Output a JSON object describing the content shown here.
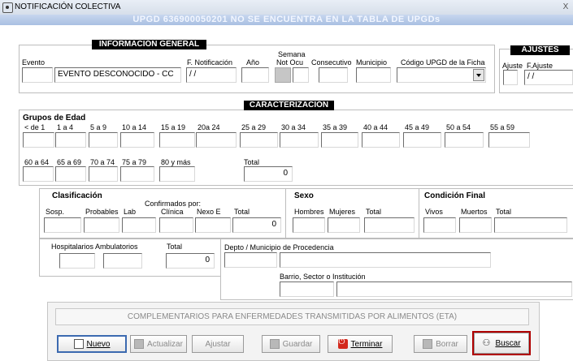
{
  "window": {
    "title": "NOTIFICACIÓN COLECTIVA",
    "close": "X"
  },
  "banner": "UPGD 636900050201 NO SE ENCUENTRA EN LA TABLA DE UPGDs",
  "general": {
    "title": "INFORMACIÓN GENERAL",
    "labels": {
      "evento": "Evento",
      "fnotif": "F. Notificación",
      "anio": "Año",
      "semana": "Semana",
      "not_ocu": "Not Ocu",
      "consecutivo": "Consecutivo",
      "municipio": "Municipio",
      "codigo_upgd": "Código UPGD de la Ficha"
    },
    "evento_nombre": "EVENTO DESCONOCIDO - CC",
    "fecha": " / /"
  },
  "ajustes": {
    "title": "AJUSTES",
    "ajuste": "Ajuste",
    "f_ajuste": "F.Ajuste",
    "fecha": " / /"
  },
  "caracterizacion": {
    "title": "CARACTERIZACIÓN",
    "grupos_label": "Grupos de Edad",
    "ages_row1": [
      "< de 1",
      "1 a 4",
      "5 a 9",
      "10 a 14",
      "15 a 19",
      "20a 24",
      "25 a 29",
      "30 a 34",
      "35 a 39",
      "40 a 44",
      "45 a 49",
      "50 a 54",
      "55 a 59"
    ],
    "ages_row2": [
      "60 a 64",
      "65 a 69",
      "70 a 74",
      "75 a 79",
      "80 y más"
    ],
    "total_label": "Total",
    "total_value": "0"
  },
  "clasificacion": {
    "title": "Clasificación",
    "confirmados": "Confirmados por:",
    "labels": [
      "Sosp.",
      "Probables",
      "Lab",
      "Clínica",
      "Nexo E",
      "Total"
    ],
    "total_value": "0"
  },
  "sexo": {
    "title": "Sexo",
    "labels": [
      "Hombres",
      "Mujeres",
      "Total"
    ]
  },
  "condicion": {
    "title": "Condición Final",
    "labels": [
      "Vivos",
      "Muertos",
      "Total"
    ]
  },
  "hospital": {
    "labels": [
      "Hospitalarios",
      "Ambulatorios",
      "Total"
    ],
    "total_value": "0"
  },
  "procedencia": {
    "depto_label": "Depto / Municipio de Procedencia",
    "barrio_label": "Barrio, Sector o Institución"
  },
  "eta_button": "COMPLEMENTARIOS PARA ENFERMEDADES TRANSMITIDAS POR ALIMENTOS (ETA)",
  "buttons": {
    "nuevo": "Nuevo",
    "actualizar": "Actualizar",
    "ajustar": "Ajustar",
    "guardar": "Guardar",
    "terminar": "Terminar",
    "borrar": "Borrar",
    "buscar": "Buscar"
  },
  "colors": {
    "banner": "#a9bfe2",
    "highlight": "#b00000",
    "terminar_icon": "#d3281c"
  },
  "icons": {
    "nuevo": "document-icon",
    "terminar": "power-icon",
    "buscar": "binoculars-icon"
  }
}
